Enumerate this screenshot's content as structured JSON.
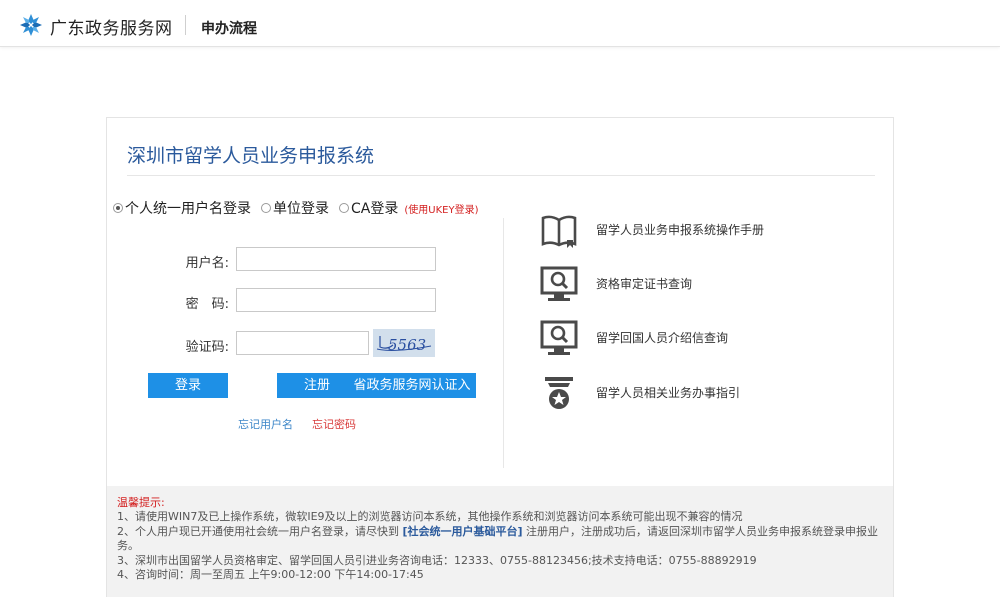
{
  "header": {
    "site_name": "广东政务服务网",
    "crumb": "申办流程"
  },
  "system": {
    "title": "深圳市留学人员业务申报系统"
  },
  "login_modes": [
    {
      "label": "个人统一用户名登录",
      "checked": true
    },
    {
      "label": "单位登录",
      "checked": false
    },
    {
      "label": "CA登录",
      "checked": false
    }
  ],
  "ukey_note": "(使用UKEY登录)",
  "form": {
    "username_label": "用户名:",
    "password_label": "密　码:",
    "captcha_label": "验证码:",
    "username_value": "",
    "password_value": "",
    "captcha_value": "",
    "captcha_text": "5563"
  },
  "buttons": {
    "login": "登录",
    "register": "注册",
    "gov_entry": "省政务服务网认证入口"
  },
  "links": {
    "forgot_username": "忘记用户名",
    "forgot_password": "忘记密码"
  },
  "quick_links": [
    {
      "label": "留学人员业务申报系统操作手册",
      "icon": "book-icon"
    },
    {
      "label": "资格审定证书查询",
      "icon": "monitor-search-icon"
    },
    {
      "label": "留学回国人员介绍信查询",
      "icon": "monitor-search-icon"
    },
    {
      "label": "留学人员相关业务办事指引",
      "icon": "guide-badge-icon"
    }
  ],
  "tips": {
    "title": "温馨提示:",
    "line1": "1、请使用WIN7及已上操作系统，微软IE9及以上的浏览器访问本系统，其他操作系统和浏览器访问本系统可能出现不兼容的情况",
    "line2_a": "2、个人用户现已开通使用社会统一用户名登录，请尽快到 ",
    "line2_link": "[社会统一用户基础平台]",
    "line2_b": " 注册用户，注册成功后，请返回深圳市留学人员业务申报系统登录申报业务。",
    "line3": "3、深圳市出国留学人员资格审定、留学回国人员引进业务咨询电话：12333、0755-88123456;技术支持电话：0755-88892919",
    "line4": "4、咨询时间：周一至周五 上午9:00-12:00 下午14:00-17:45"
  },
  "colors": {
    "primary_button": "#1e90e6",
    "title_blue": "#2b5a9c",
    "alert_red": "#d31e1e"
  }
}
